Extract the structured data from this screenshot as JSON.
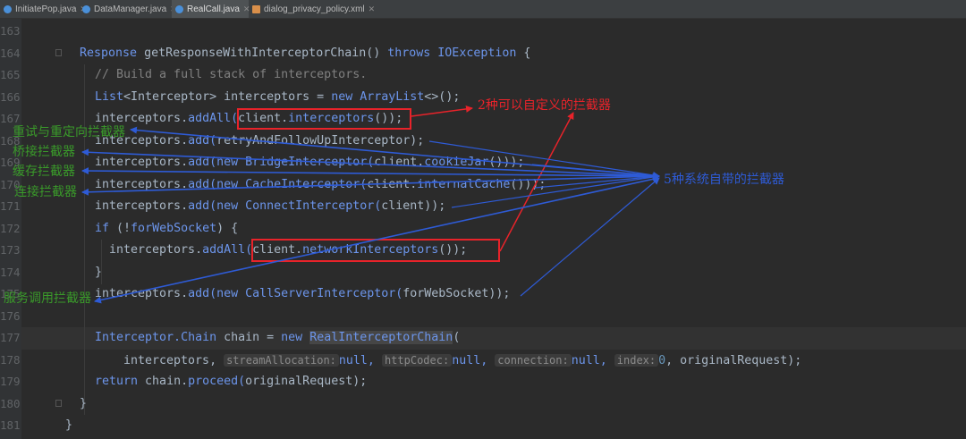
{
  "tabs": [
    {
      "label": "InitiatePop.java",
      "icon_color": "#4a90d9"
    },
    {
      "label": "DataManager.java",
      "icon_color": "#4a90d9"
    },
    {
      "label": "RealCall.java",
      "icon_color": "#4a90d9",
      "active": true
    },
    {
      "label": "dialog_privacy_policy.xml",
      "icon_color": "#d98f4a"
    }
  ],
  "line_numbers": [
    "163",
    "164",
    "165",
    "166",
    "167",
    "168",
    "169",
    "170",
    "171",
    "172",
    "173",
    "174",
    "175",
    "176",
    "177",
    "178",
    "179",
    "180",
    "181"
  ],
  "code": {
    "l164_kw1": "Response ",
    "l164_fn": "getResponseWithInterceptorChain() ",
    "l164_kw2": "throws ",
    "l164_cls": "IOException ",
    "l164_brace": "{",
    "l165": "// Build a full stack of interceptors.",
    "l166_a": "List",
    "l166_b": "<Interceptor> ",
    "l166_c": "interceptors = ",
    "l166_d": "new ",
    "l166_e": "ArrayList",
    "l166_f": "<>();",
    "l167_a": "interceptors.",
    "l167_b": "addAll(",
    "l167_c": "client.",
    "l167_d": "interceptors",
    "l167_e": "());",
    "l168_a": "interceptors.",
    "l168_b": "add(",
    "l168_c": "retryAndFollowUpInterceptor);",
    "l169_a": "interceptors.",
    "l169_b": "add(",
    "l169_c": "new ",
    "l169_d": "BridgeInterceptor(",
    "l169_e": "client.",
    "l169_f": "cookieJar",
    "l169_g": "()));",
    "l170_a": "interceptors.",
    "l170_b": "add(",
    "l170_c": "new ",
    "l170_d": "CacheInterceptor(",
    "l170_e": "client.",
    "l170_f": "internalCache",
    "l170_g": "()));",
    "l171_a": "interceptors.",
    "l171_b": "add(",
    "l171_c": "new ",
    "l171_d": "ConnectInterceptor(",
    "l171_e": "client));",
    "l172_a": "if ",
    "l172_b": "(!",
    "l172_c": "forWebSocket",
    "l172_d": ") {",
    "l173_a": "interceptors.",
    "l173_b": "addAll(",
    "l173_c": "client.",
    "l173_d": "networkInterceptors",
    "l173_e": "());",
    "l174": "}",
    "l175_a": "interceptors.",
    "l175_b": "add(",
    "l175_c": "new ",
    "l175_d": "CallServerInterceptor(",
    "l175_e": "forWebSocket));",
    "l177_a": "Interceptor.",
    "l177_b": "Chain ",
    "l177_c": "chain = ",
    "l177_d": "new ",
    "l177_e": "RealInterceptorChain",
    "l177_f": "(",
    "l178_a": "interceptors, ",
    "l178_h1": "streamAllocation:",
    "l178_b": "null, ",
    "l178_h2": "httpCodec:",
    "l178_c": "null, ",
    "l178_h3": "connection:",
    "l178_d": "null, ",
    "l178_h4": "index:",
    "l178_e": "0",
    "l178_f": ", originalRequest);",
    "l179_a": "return ",
    "l179_b": "chain.",
    "l179_c": "proceed(",
    "l179_d": "originalRequest);",
    "l180": "}",
    "l181": "}"
  },
  "annotations": {
    "retry": "重试与重定向拦截器",
    "bridge": "桥接拦截器",
    "cache": "缓存拦截器",
    "connect": "连接拦截器",
    "callserver": "服务调用拦截器",
    "custom": "2种可以自定义的拦截器",
    "system": "5种系统自带的拦截器"
  },
  "colors": {
    "annotation_red": "#e8232a",
    "annotation_blue": "#2e5bd6",
    "annotation_green": "#3a9a2a"
  }
}
